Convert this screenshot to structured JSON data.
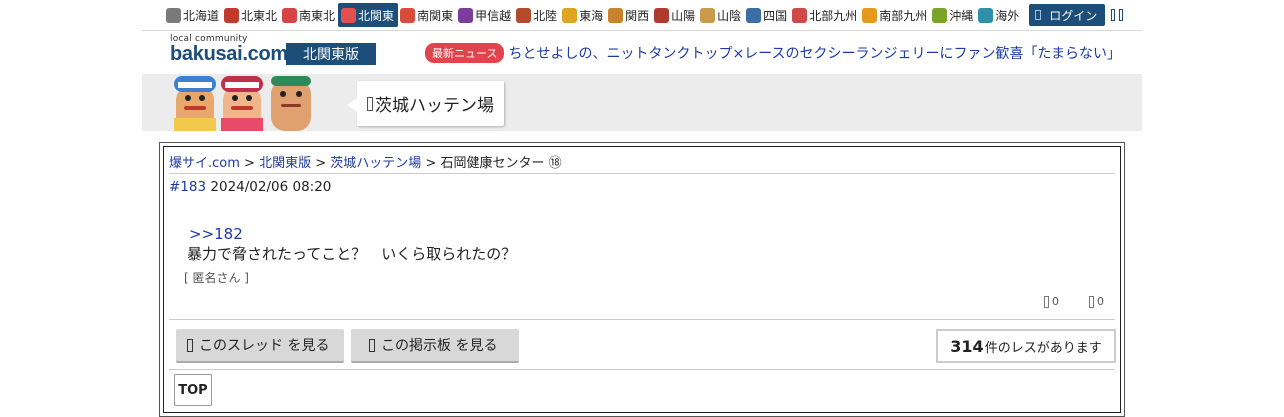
{
  "nav": {
    "regions": [
      {
        "label": "北海道",
        "icon": "hokkaido-icon",
        "color": "#7a7a7a"
      },
      {
        "label": "北東北",
        "icon": "tohoku-north-icon",
        "color": "#c0392b"
      },
      {
        "label": "南東北",
        "icon": "tohoku-south-icon",
        "color": "#d64545"
      },
      {
        "label": "北関東",
        "icon": "kanto-north-icon",
        "color": "#e45050"
      },
      {
        "label": "南関東",
        "icon": "tower-icon",
        "color": "#d94b3a"
      },
      {
        "label": "甲信越",
        "icon": "grape-icon",
        "color": "#7a3d9c"
      },
      {
        "label": "北陸",
        "icon": "torii-icon",
        "color": "#b24a2b"
      },
      {
        "label": "東海",
        "icon": "shachihoko-icon",
        "color": "#e0a51f"
      },
      {
        "label": "関西",
        "icon": "takoyaki-icon",
        "color": "#c9832b"
      },
      {
        "label": "山陽",
        "icon": "shrine-icon",
        "color": "#b03a2e"
      },
      {
        "label": "山陰",
        "icon": "camel-icon",
        "color": "#c99a4a"
      },
      {
        "label": "四国",
        "icon": "udon-icon",
        "color": "#3a6ea5"
      },
      {
        "label": "北部九州",
        "icon": "fish-icon",
        "color": "#d04848"
      },
      {
        "label": "南部九州",
        "icon": "mango-icon",
        "color": "#e69a1c"
      },
      {
        "label": "沖縄",
        "icon": "shisa-icon",
        "color": "#7aa32a"
      },
      {
        "label": "海外",
        "icon": "globe-icon",
        "color": "#2f8fa8"
      }
    ],
    "active_index": 3,
    "login_label": "ログイン"
  },
  "header": {
    "logo_small": "local community",
    "logo_main": "bakusai.com",
    "edition": "北関東版",
    "news_badge": "最新ニュース",
    "news_text": "ちとせよしの、ニットタンクトップ×レースのセクシーランジェリーにファン歓喜「たまらない」"
  },
  "banner": {
    "board_title": "茨城ハッテン場"
  },
  "breadcrumb": {
    "site": "爆サイ.com",
    "edition": "北関東版",
    "board": "茨城ハッテン場",
    "thread": "石岡健康センター ⑱",
    "sep": " > "
  },
  "post": {
    "number": "#183",
    "datetime": "2024/02/06 08:20",
    "reply_to": ">>182",
    "body": "暴力で脅されたってこと？　いくら取られたの？",
    "author": "[ 匿名さん ]",
    "likes": "0",
    "dislikes": "0"
  },
  "actions": {
    "view_thread": "このスレッド を見る",
    "view_board": "この掲示板 を見る",
    "res_count": "314",
    "res_suffix": "件のレスがあります",
    "top": "TOP"
  }
}
